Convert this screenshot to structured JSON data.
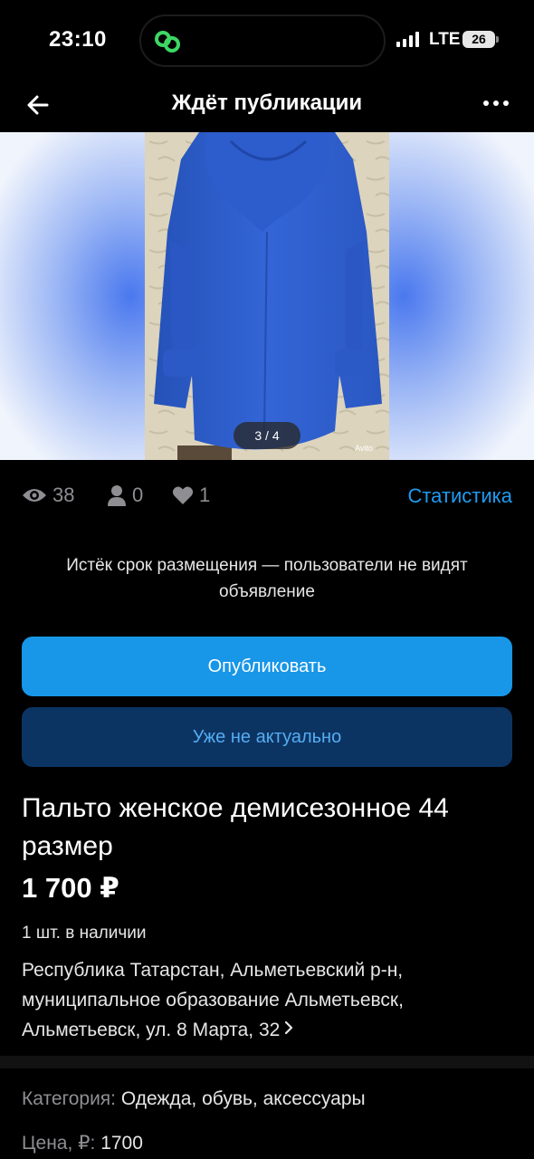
{
  "status_bar": {
    "time": "23:10",
    "network": "LTE",
    "battery": "26"
  },
  "nav": {
    "title": "Ждёт публикации",
    "back_icon": "arrow-left-icon",
    "menu_icon": "more-horizontal-icon"
  },
  "gallery": {
    "counter": "3 / 4",
    "current": 3,
    "total": 4,
    "watermark": "Avito"
  },
  "stats": {
    "views": "38",
    "contacts": "0",
    "favorites": "1",
    "link": "Статистика"
  },
  "notice": "Истёк срок размещения — пользователи не видят объявление",
  "buttons": {
    "publish": "Опубликовать",
    "not_relevant": "Уже не актуально"
  },
  "listing": {
    "title": "Пальто женское демисезонное 44 размер",
    "price": "1 700 ₽",
    "stock": "1 шт. в наличии",
    "address": "Республика Татарстан, Альметьевский р-н, муниципальное образование Альметьевск, Альметьевск, ул. 8 Марта, 32"
  },
  "params": [
    {
      "label": "Категория:",
      "value": "Одежда, обувь, аксессуары"
    },
    {
      "label": "Цена, ₽:",
      "value": "1700"
    }
  ],
  "colors": {
    "accent": "#1896e8",
    "link": "#1e9cf0",
    "secondary_button": "#0c3463",
    "coat": "#2f5fd0"
  }
}
